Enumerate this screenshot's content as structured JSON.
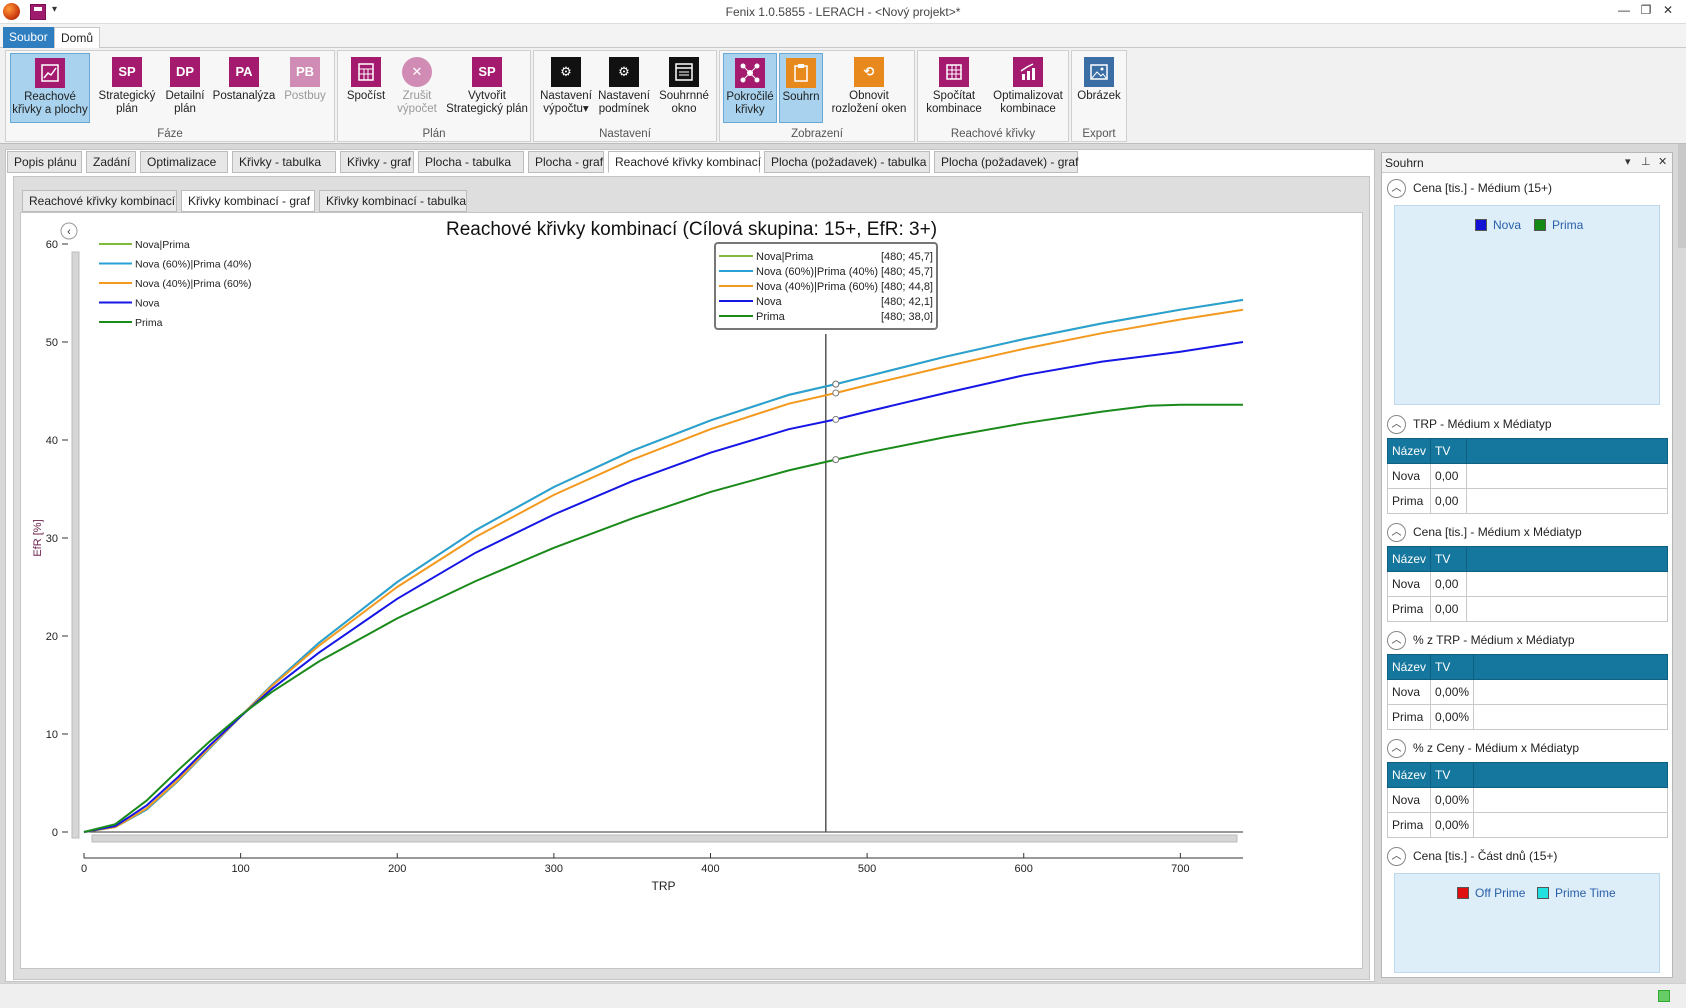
{
  "window": {
    "title": "Fenix 1.0.5855 - LERACH - <Nový projekt>*"
  },
  "menu": {
    "file": "Soubor",
    "home": "Domů"
  },
  "ribbon": {
    "groups": [
      {
        "label": "Fáze",
        "buttons": [
          {
            "icon": "reach-curves-icon",
            "label1": "Reachové",
            "label2": "křivky a plochy",
            "glyph": "",
            "active": true
          },
          {
            "icon": "sp-icon",
            "label1": "Strategický",
            "label2": "plán",
            "glyph": "SP"
          },
          {
            "icon": "dp-icon",
            "label1": "Detailní",
            "label2": "plán",
            "glyph": "DP"
          },
          {
            "icon": "pa-icon",
            "label1": "Postanalýza",
            "label2": "",
            "glyph": "PA"
          },
          {
            "icon": "pb-icon",
            "label1": "Postbuy",
            "label2": "",
            "glyph": "PB",
            "disabled": true
          }
        ]
      },
      {
        "label": "Plán",
        "buttons": [
          {
            "icon": "calculate-icon",
            "label1": "Spočíst",
            "label2": ""
          },
          {
            "icon": "cancel-icon",
            "label1": "Zrušit",
            "label2": "výpočet",
            "disabled": true
          },
          {
            "icon": "sp-icon",
            "label1": "Vytvořit",
            "label2": "Strategický plán",
            "glyph": "SP"
          }
        ]
      },
      {
        "label": "Nastavení",
        "buttons": [
          {
            "icon": "gear-icon",
            "label1": "Nastavení",
            "label2": "výpočtu▾"
          },
          {
            "icon": "gear-icon",
            "label1": "Nastavení",
            "label2": "podmínek"
          },
          {
            "icon": "window-icon",
            "label1": "Souhrnné",
            "label2": "okno"
          }
        ]
      },
      {
        "label": "Zobrazení",
        "buttons": [
          {
            "icon": "network-icon",
            "label1": "Pokročilé",
            "label2": "křivky",
            "active": true
          },
          {
            "icon": "clipboard-icon",
            "label1": "Souhrn",
            "label2": "",
            "active": true
          },
          {
            "icon": "refresh-icon",
            "label1": "Obnovit",
            "label2": "rozložení oken"
          }
        ]
      },
      {
        "label": "Reachové křivky",
        "buttons": [
          {
            "icon": "grid-icon",
            "label1": "Spočítat",
            "label2": "kombinace"
          },
          {
            "icon": "chart-icon",
            "label1": "Optimalizovat",
            "label2": "kombinace"
          }
        ]
      },
      {
        "label": "Export",
        "buttons": [
          {
            "icon": "image-icon",
            "label1": "Obrázek",
            "label2": ""
          }
        ]
      }
    ]
  },
  "tabs": [
    "Popis plánu",
    "Zadání",
    "Optimalizace",
    "Křivky - tabulka",
    "Křivky - graf",
    "Plocha - tabulka",
    "Plocha - graf",
    "Reachové křivky kombinací",
    "Plocha (požadavek) - tabulka",
    "Plocha (požadavek) - graf"
  ],
  "subtabs": [
    "Reachové křivky kombinací",
    "Křivky kombinací - graf",
    "Křivky kombinací - tabulka"
  ],
  "chart_data": {
    "type": "line",
    "title": "Reachové křivky kombinací (Cílová skupina: 15+, EfR: 3+)",
    "xlabel": "TRP",
    "ylabel": "EfR [%]",
    "xlim": [
      0,
      740
    ],
    "ylim": [
      0,
      60
    ],
    "xticks": [
      0,
      100,
      200,
      300,
      400,
      500,
      600,
      700
    ],
    "yticks": [
      0,
      10,
      20,
      30,
      40,
      50,
      60
    ],
    "legend_position": "top-left",
    "series": [
      {
        "name": "Nova|Prima",
        "color": "#7fba3a",
        "x": [
          0,
          20,
          40,
          60,
          80,
          100,
          120,
          150,
          200,
          250,
          300,
          350,
          400,
          450,
          480,
          500,
          550,
          600,
          650,
          700,
          740
        ],
        "y": [
          0,
          0.5,
          2.3,
          5.2,
          8.5,
          11.8,
          15.0,
          19.3,
          25.5,
          30.8,
          35.2,
          38.9,
          42.0,
          44.6,
          45.7,
          46.5,
          48.5,
          50.3,
          51.9,
          53.3,
          54.3
        ]
      },
      {
        "name": "Nova (60%)|Prima (40%)",
        "color": "#2aa0d6",
        "x": [
          0,
          20,
          40,
          60,
          80,
          100,
          120,
          150,
          200,
          250,
          300,
          350,
          400,
          450,
          480,
          500,
          550,
          600,
          650,
          700,
          740
        ],
        "y": [
          0,
          0.5,
          2.3,
          5.2,
          8.5,
          11.8,
          15.0,
          19.3,
          25.5,
          30.8,
          35.2,
          38.9,
          42.0,
          44.6,
          45.7,
          46.5,
          48.5,
          50.3,
          51.9,
          53.3,
          54.3
        ]
      },
      {
        "name": "Nova (40%)|Prima (60%)",
        "color": "#f39a1e",
        "x": [
          0,
          20,
          40,
          60,
          80,
          100,
          120,
          150,
          200,
          250,
          300,
          350,
          400,
          450,
          480,
          500,
          550,
          600,
          650,
          700,
          740
        ],
        "y": [
          0,
          0.5,
          2.4,
          5.3,
          8.6,
          11.8,
          14.9,
          19.0,
          25.0,
          30.1,
          34.4,
          38.0,
          41.1,
          43.7,
          44.8,
          45.6,
          47.5,
          49.3,
          50.9,
          52.3,
          53.3
        ]
      },
      {
        "name": "Nova",
        "color": "#1616e6",
        "x": [
          0,
          20,
          40,
          60,
          80,
          100,
          120,
          150,
          200,
          250,
          300,
          350,
          400,
          450,
          480,
          500,
          550,
          600,
          650,
          700,
          740
        ],
        "y": [
          0,
          0.6,
          2.7,
          5.6,
          8.8,
          11.8,
          14.6,
          18.3,
          23.8,
          28.5,
          32.4,
          35.8,
          38.7,
          41.1,
          42.1,
          42.9,
          44.8,
          46.6,
          48.0,
          49.0,
          50.0
        ]
      },
      {
        "name": "Prima",
        "color": "#1a8a1a",
        "x": [
          0,
          20,
          40,
          60,
          80,
          100,
          120,
          150,
          200,
          250,
          300,
          350,
          400,
          450,
          480,
          500,
          550,
          600,
          650,
          680,
          700,
          740
        ],
        "y": [
          0,
          0.8,
          3.2,
          6.3,
          9.2,
          11.9,
          14.3,
          17.4,
          21.8,
          25.6,
          29.0,
          32.0,
          34.7,
          36.9,
          38.0,
          38.7,
          40.3,
          41.7,
          42.9,
          43.5,
          43.6,
          43.6
        ]
      }
    ],
    "tooltip": {
      "x": 480,
      "rows": [
        {
          "name": "Nova|Prima",
          "value": "[480; 45,7]",
          "color": "#7fba3a"
        },
        {
          "name": "Nova (60%)|Prima (40%)",
          "value": "[480; 45,7]",
          "color": "#2aa0d6"
        },
        {
          "name": "Nova (40%)|Prima (60%)",
          "value": "[480; 44,8]",
          "color": "#f39a1e"
        },
        {
          "name": "Nova",
          "value": "[480; 42,1]",
          "color": "#1616e6"
        },
        {
          "name": "Prima",
          "value": "[480; 38,0]",
          "color": "#1a8a1a"
        }
      ]
    }
  },
  "side": {
    "title": "Souhrn",
    "sec1": {
      "label": "Cena [tis.] - Médium (15+)",
      "legend": [
        {
          "name": "Nova",
          "color": "#1212d6"
        },
        {
          "name": "Prima",
          "color": "#138a13"
        }
      ]
    },
    "tables": [
      {
        "label": "TRP - Médium x Médiatyp",
        "h1": "Název",
        "h2": "TV",
        "rows": [
          [
            "Nova",
            "0,00"
          ],
          [
            "Prima",
            "0,00"
          ]
        ]
      },
      {
        "label": "Cena [tis.] - Médium x Médiatyp",
        "h1": "Název",
        "h2": "TV",
        "rows": [
          [
            "Nova",
            "0,00"
          ],
          [
            "Prima",
            "0,00"
          ]
        ]
      },
      {
        "label": "% z TRP - Médium x Médiatyp",
        "h1": "Název",
        "h2": "TV",
        "rows": [
          [
            "Nova",
            "0,00%"
          ],
          [
            "Prima",
            "0,00%"
          ]
        ]
      },
      {
        "label": "% z Ceny - Médium x Médiatyp",
        "h1": "Název",
        "h2": "TV",
        "rows": [
          [
            "Nova",
            "0,00%"
          ],
          [
            "Prima",
            "0,00%"
          ]
        ]
      }
    ],
    "sec6": {
      "label": "Cena [tis.] - Část dnů (15+)",
      "legend": [
        {
          "name": "Off Prime",
          "color": "#e01010"
        },
        {
          "name": "Prime Time",
          "color": "#20e0e0"
        }
      ]
    }
  }
}
